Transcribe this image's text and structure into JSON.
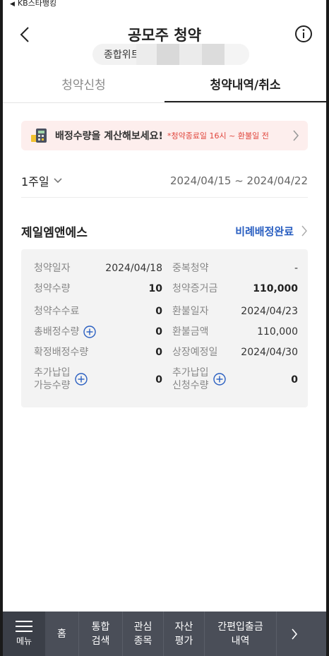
{
  "status_bar": {
    "carrier": "KB스타뱅킹"
  },
  "header": {
    "title": "공모주 청약"
  },
  "account": {
    "label": "종합위트"
  },
  "tabs": [
    {
      "label": "청약신청",
      "active": false
    },
    {
      "label": "청약내역/취소",
      "active": true
    }
  ],
  "banner": {
    "main": "배정수량을 계산해보세요!",
    "note": "*청약종료일 16시 ~ 환불일 전"
  },
  "filter": {
    "period": "1주일",
    "date_range": "2024/04/15 ~ 2024/04/22"
  },
  "item": {
    "name": "제일엠앤에스",
    "status": "비례배정완료",
    "details": {
      "r1": {
        "l_label": "청약일자",
        "l_value": "2024/04/18",
        "r_label": "중복청약",
        "r_value": "-"
      },
      "r2": {
        "l_label": "청약수량",
        "l_value": "10",
        "r_label": "청약증거금",
        "r_value": "110,000"
      },
      "r3": {
        "l_label": "청약수수료",
        "l_value": "0",
        "r_label": "환불일자",
        "r_value": "2024/04/23"
      },
      "r4": {
        "l_label": "총배정수량",
        "l_value": "0",
        "r_label": "환불금액",
        "r_value": "110,000"
      },
      "r5": {
        "l_label": "확정배정수량",
        "l_value": "0",
        "r_label": "상장예정일",
        "r_value": "2024/04/30"
      },
      "r6": {
        "l_label_1": "추가납입",
        "l_label_2": "가능수량",
        "l_value": "0",
        "r_label_1": "추가납입",
        "r_label_2": "신청수량",
        "r_value": "0"
      }
    }
  },
  "bottom_nav": {
    "menu": "메뉴",
    "home": "홈",
    "search_1": "통합",
    "search_2": "검색",
    "watch_1": "관심",
    "watch_2": "종목",
    "asset_1": "자산",
    "asset_2": "평가",
    "transfer_1": "간편입출금",
    "transfer_2": "내역"
  },
  "colors": {
    "accent_blue": "#2a5fc1",
    "banner_bg": "#fdeeed",
    "banner_note": "#e0453c",
    "nav_bg": "#4a4e58"
  }
}
